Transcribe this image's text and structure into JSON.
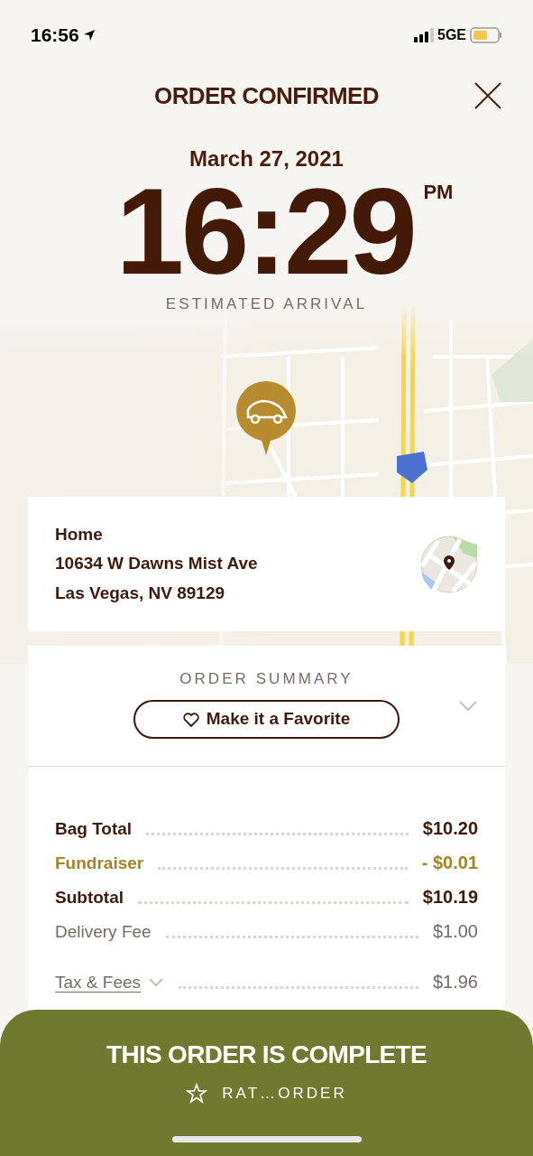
{
  "status_bar": {
    "time": "16:56",
    "network": "5GE"
  },
  "header": {
    "title": "ORDER CONFIRMED"
  },
  "eta": {
    "date": "March 27, 2021",
    "time": "16:29",
    "meridiem": "PM",
    "label": "ESTIMATED ARRIVAL"
  },
  "delivery": {
    "name": "Home",
    "address_lines": [
      "10634 W Dawns Mist Ave",
      "Las Vegas, NV 89129"
    ]
  },
  "summary": {
    "heading": "ORDER SUMMARY",
    "favorite_button": "Make it a Favorite",
    "expanded": false,
    "items": [
      {
        "kind": "total",
        "label": "Bag Total",
        "amount": "$10.20"
      },
      {
        "kind": "discount",
        "label": "Fundraiser",
        "amount": "- $0.01"
      },
      {
        "kind": "total",
        "label": "Subtotal",
        "amount": "$10.19"
      },
      {
        "kind": "fee",
        "label": "Delivery Fee",
        "amount": "$1.00"
      },
      {
        "kind": "expandable",
        "label": "Tax & Fees",
        "amount": "$1.96",
        "expanded": false
      }
    ]
  },
  "footer": {
    "title": "THIS ORDER IS COMPLETE",
    "rate_button": "RAT…ORDER"
  }
}
